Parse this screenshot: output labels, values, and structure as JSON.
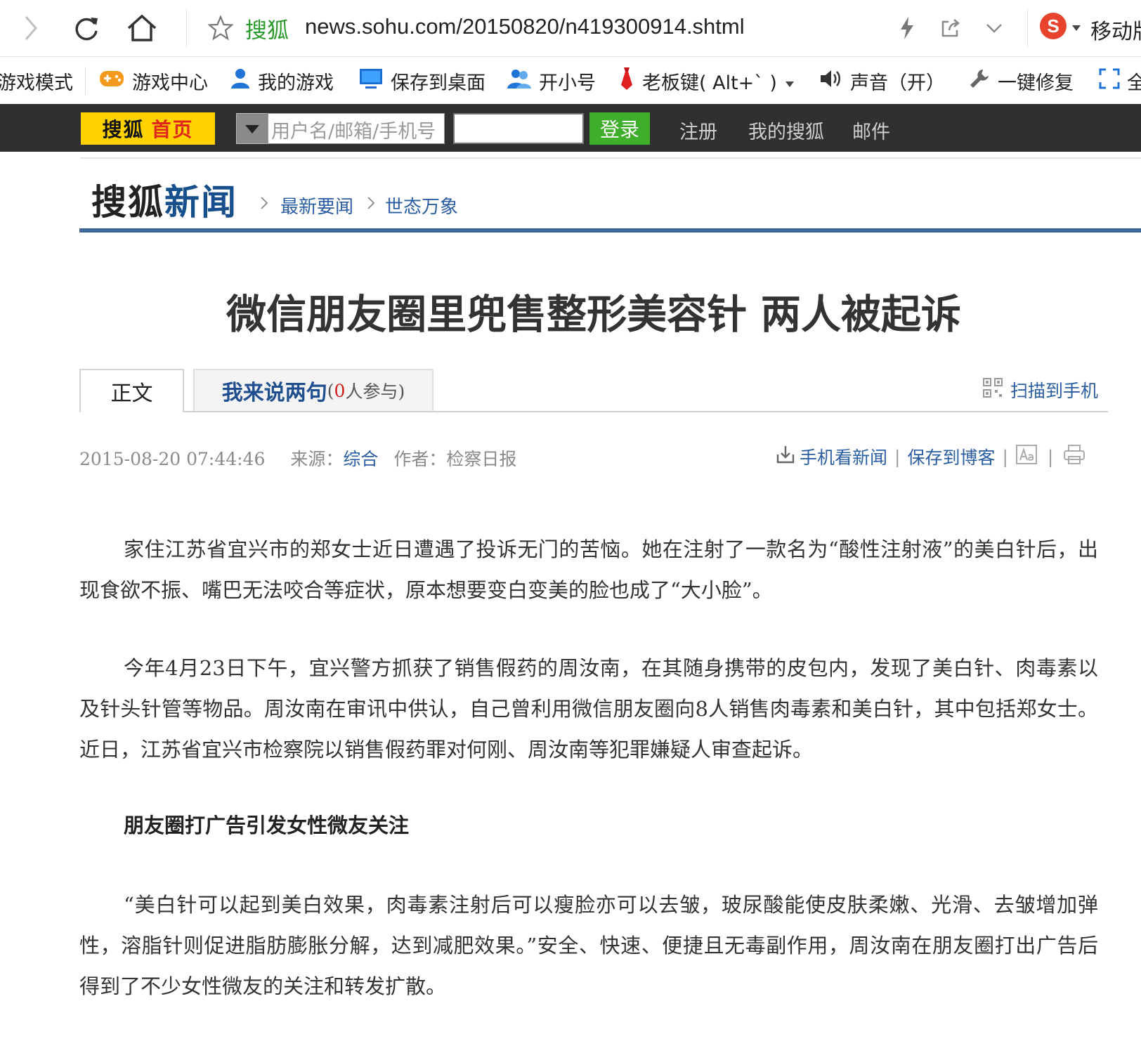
{
  "browser": {
    "site_label": "搜狐",
    "url": "news.sohu.com/20150820/n419300914.shtml",
    "right_text": "移动版"
  },
  "toolbar": {
    "items": [
      {
        "label": "游戏模式",
        "icon": "gamepad-mode-icon"
      },
      {
        "label": "游戏中心",
        "icon": "gamepad-icon"
      },
      {
        "label": "我的游戏",
        "icon": "user-icon"
      },
      {
        "label": "保存到桌面",
        "icon": "monitor-icon"
      },
      {
        "label": "开小号",
        "icon": "users-icon"
      },
      {
        "label": "老板键( Alt+` )",
        "icon": "tie-icon"
      },
      {
        "label": "声音（开）",
        "icon": "speaker-icon"
      },
      {
        "label": "一键修复",
        "icon": "wrench-icon"
      },
      {
        "label": "全",
        "icon": "fullscreen-icon"
      }
    ]
  },
  "sohubar": {
    "home_a": "搜狐",
    "home_b": "首页",
    "username_placeholder": "用户名/邮箱/手机号",
    "login": "登录",
    "links": [
      "注册",
      "我的搜狐",
      "邮件"
    ]
  },
  "header": {
    "logo_a": "搜狐",
    "logo_b": "新闻",
    "breadcrumb": [
      "最新要闻",
      "世态万象"
    ]
  },
  "article": {
    "title": "微信朋友圈里兜售整形美容针  两人被起诉",
    "tab_main": "正文",
    "tab_comment": "我来说两句",
    "tab_comment_open": "(",
    "tab_comment_count": "0",
    "tab_comment_suffix": "人参与)",
    "scan": "扫描到手机",
    "date": "2015-08-20 07:44:46",
    "source_label": "来源：",
    "source": "综合",
    "author_label": "作者：",
    "author": "检察日报",
    "tool_mobile": "手机看新闻",
    "tool_blog": "保存到博客",
    "paragraphs": [
      "家住江苏省宜兴市的郑女士近日遭遇了投诉无门的苦恼。她在注射了一款名为“酸性注射液”的美白针后，出现食欲不振、嘴巴无法咬合等症状，原本想要变白变美的脸也成了“大小脸”。",
      "今年4月23日下午，宜兴警方抓获了销售假药的周汝南，在其随身携带的皮包内，发现了美白针、肉毒素以及针头针管等物品。周汝南在审讯中供认，自己曾利用微信朋友圈向8人销售肉毒素和美白针，其中包括郑女士。近日，江苏省宜兴市检察院以销售假药罪对何刚、周汝南等犯罪嫌疑人审查起诉。",
      "朋友圈打广告引发女性微友关注",
      "“美白针可以起到美白效果，肉毒素注射后可以瘦脸亦可以去皱，玻尿酸能使皮肤柔嫩、光滑、去皱增加弹性，溶脂针则促进脂肪膨胀分解，达到减肥效果。”安全、快速、便捷且无毒副作用，周汝南在朋友圈打出广告后得到了不少女性微友的关注和转发扩散。"
    ]
  },
  "colors": {
    "darkbar": "#303030",
    "home_yellow": "#ffd200",
    "login_green": "#3fae2a",
    "link_blue": "#2a5da3",
    "rule_blue": "#3d6796"
  }
}
